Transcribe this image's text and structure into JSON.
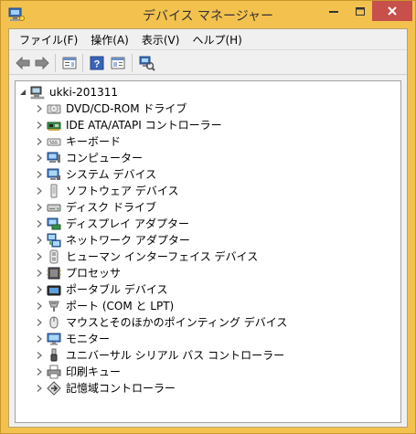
{
  "window": {
    "title": "デバイス マネージャー"
  },
  "menu": [
    {
      "label": "ファイル(F)"
    },
    {
      "label": "操作(A)"
    },
    {
      "label": "表示(V)"
    },
    {
      "label": "ヘルプ(H)"
    }
  ],
  "toolbar": [
    "back-icon",
    "forward-icon",
    "properties-icon",
    "help-icon",
    "view-icon",
    "scan-hardware-icon"
  ],
  "tree": {
    "root": "ukki-201311",
    "items": [
      {
        "label": "DVD/CD-ROM ドライブ",
        "icon": "dvd-drive-icon"
      },
      {
        "label": "IDE ATA/ATAPI コントローラー",
        "icon": "ide-controller-icon"
      },
      {
        "label": "キーボード",
        "icon": "keyboard-icon"
      },
      {
        "label": "コンピューター",
        "icon": "computer-icon"
      },
      {
        "label": "システム デバイス",
        "icon": "system-device-icon"
      },
      {
        "label": "ソフトウェア デバイス",
        "icon": "software-device-icon"
      },
      {
        "label": "ディスク ドライブ",
        "icon": "disk-drive-icon"
      },
      {
        "label": "ディスプレイ アダプター",
        "icon": "display-adapter-icon"
      },
      {
        "label": "ネットワーク アダプター",
        "icon": "network-adapter-icon"
      },
      {
        "label": "ヒューマン インターフェイス デバイス",
        "icon": "hid-icon"
      },
      {
        "label": "プロセッサ",
        "icon": "processor-icon"
      },
      {
        "label": "ポータブル デバイス",
        "icon": "portable-device-icon"
      },
      {
        "label": "ポート (COM と LPT)",
        "icon": "port-icon"
      },
      {
        "label": "マウスとそのほかのポインティング デバイス",
        "icon": "mouse-icon"
      },
      {
        "label": "モニター",
        "icon": "monitor-icon"
      },
      {
        "label": "ユニバーサル シリアル バス コントローラー",
        "icon": "usb-icon"
      },
      {
        "label": "印刷キュー",
        "icon": "printer-icon"
      },
      {
        "label": "記憶域コントローラー",
        "icon": "storage-controller-icon"
      }
    ]
  }
}
